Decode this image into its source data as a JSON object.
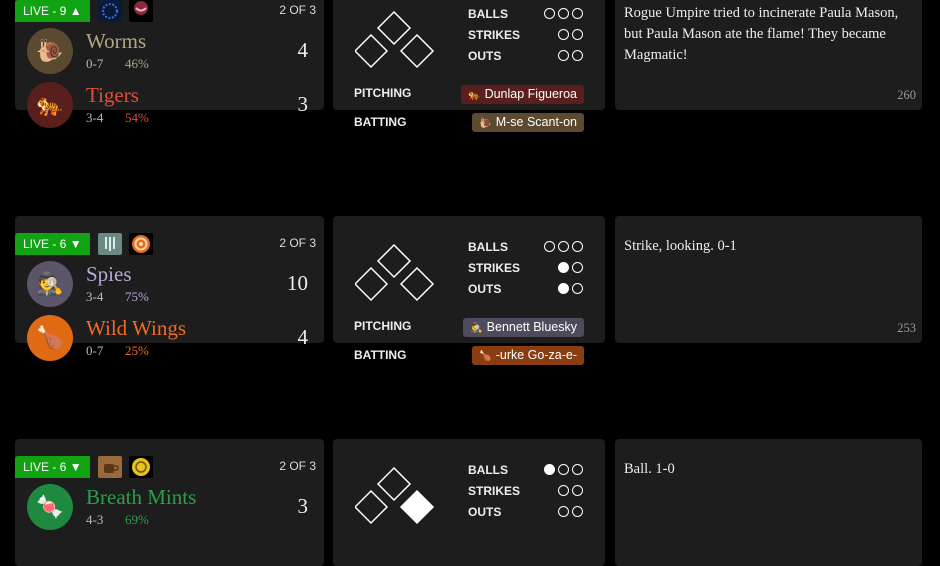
{
  "games": [
    {
      "live": "LIVE - 9 ▲",
      "weather_icons": [
        "eclipse-weather-icon",
        "peanuts-weather-icon"
      ],
      "series": "2 OF 3",
      "away": {
        "name": "Worms",
        "emoji": "🐌",
        "record": "0-7",
        "pct": "46%",
        "score": "4",
        "color": "#b5a583",
        "icon_bg": "#5b4930"
      },
      "home": {
        "name": "Tigers",
        "emoji": "🐅",
        "record": "3-4",
        "pct": "54%",
        "score": "3",
        "color": "#e04e3b",
        "icon_bg": "#5a1f1c"
      },
      "count": {
        "balls_label": "BALLS",
        "strikes_label": "STRIKES",
        "outs_label": "OUTS",
        "balls": 0,
        "strikes": 0,
        "outs": 0,
        "balls_max": 3,
        "strikes_max": 2,
        "outs_max": 2
      },
      "bases_occupied": [],
      "pitching_label": "PITCHING",
      "batting_label": "BATTING",
      "pitcher": {
        "name": "Dunlap Figueroa",
        "emoji": "🐅",
        "chip_color": "#5a1f1c"
      },
      "batter": {
        "name": "M-se Scant-on",
        "emoji": "🐌",
        "chip_color": "#5b4930"
      },
      "log": "Rogue Umpire tried to incinerate Paula Mason, but Paula Mason ate the flame! They became Magmatic!",
      "log_num": "260"
    },
    {
      "live": "LIVE - 6 ▼",
      "weather_icons": [
        "rain-weather-icon",
        "target-weather-icon"
      ],
      "series": "2 OF 3",
      "away": {
        "name": "Spies",
        "emoji": "🕵",
        "record": "3-4",
        "pct": "75%",
        "score": "10",
        "color": "#b9a7d6",
        "icon_bg": "#5c5468"
      },
      "home": {
        "name": "Wild Wings",
        "emoji": "🍗",
        "record": "0-7",
        "pct": "25%",
        "score": "4",
        "color": "#f06b27",
        "icon_bg": "#e16b14"
      },
      "count": {
        "balls_label": "BALLS",
        "strikes_label": "STRIKES",
        "outs_label": "OUTS",
        "balls": 0,
        "strikes": 1,
        "outs": 1,
        "balls_max": 3,
        "strikes_max": 2,
        "outs_max": 2
      },
      "bases_occupied": [],
      "pitching_label": "PITCHING",
      "batting_label": "BATTING",
      "pitcher": {
        "name": "Bennett Bluesky",
        "emoji": "🕵",
        "chip_color": "#4f4a5c"
      },
      "batter": {
        "name": "-urke Go-za-e-",
        "emoji": "🍗",
        "chip_color": "#8a3d10"
      },
      "log": "Strike, looking. 0-1",
      "log_num": "253"
    },
    {
      "live": "LIVE - 6 ▼",
      "weather_icons": [
        "coffee-weather-icon",
        "coin-weather-icon"
      ],
      "series": "2 OF 3",
      "away": {
        "name": "Breath Mints",
        "emoji": "🍬",
        "record": "4-3",
        "pct": "69%",
        "score": "3",
        "color": "#2e9e4b",
        "icon_bg": "#1f8a3f"
      },
      "count": {
        "balls_label": "BALLS",
        "strikes_label": "STRIKES",
        "outs_label": "OUTS",
        "balls": 1,
        "strikes": 0,
        "outs": 0,
        "balls_max": 3,
        "strikes_max": 2,
        "outs_max": 2
      },
      "bases_occupied": [
        1
      ],
      "log": "Ball. 1-0"
    }
  ]
}
